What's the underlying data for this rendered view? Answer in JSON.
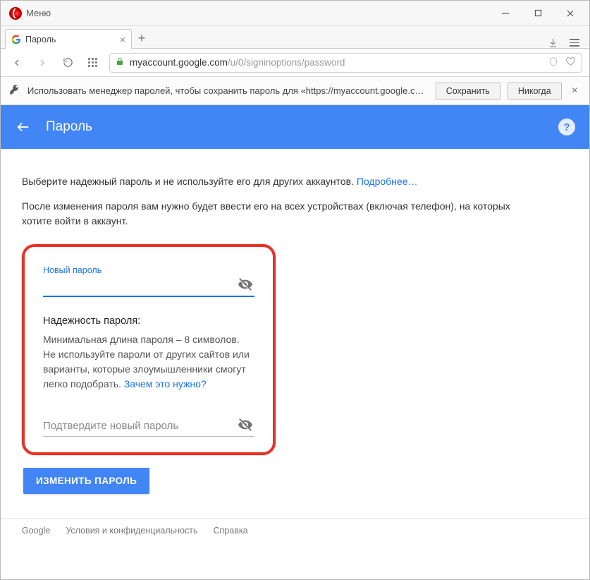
{
  "window": {
    "menu_label": "Меню"
  },
  "tab": {
    "title": "Пароль"
  },
  "address": {
    "host": "myaccount.google.com",
    "path": "/u/0/signinoptions/password"
  },
  "savebar": {
    "text": "Использовать менеджер паролей, чтобы сохранить пароль для «https://myaccount.google.c…",
    "save": "Сохранить",
    "never": "Никогда"
  },
  "gheader": {
    "title": "Пароль"
  },
  "intro": {
    "line1a": "Выберите надежный пароль и не используйте его для других аккаунтов. ",
    "line1_link": "Подробнее…",
    "line2": "После изменения пароля вам нужно будет ввести его на всех устройствах (включая телефон), на которых хотите войти в аккаунт."
  },
  "form": {
    "new_label": "Новый пароль",
    "new_value": "",
    "strength_title": "Надежность пароля:",
    "strength_body": "Минимальная длина пароля – 8 символов. Не используйте пароли от других сайтов или варианты, которые злоумышленники смогут легко подобрать. ",
    "strength_link": "Зачем это нужно?",
    "confirm_placeholder": "Подтвердите новый пароль",
    "confirm_value": "",
    "submit": "ИЗМЕНИТЬ ПАРОЛЬ"
  },
  "footer": {
    "brand": "Google",
    "terms": "Условия и конфиденциальность",
    "help": "Справка"
  }
}
